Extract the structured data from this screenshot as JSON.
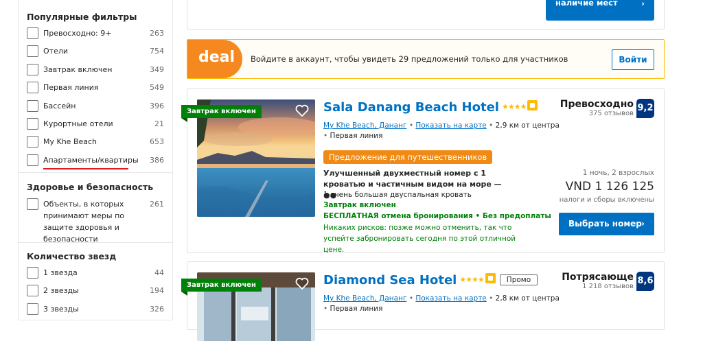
{
  "sidebar": {
    "popular": {
      "title": "Популярные фильтры",
      "items": [
        {
          "label": "Превосходно: 9+",
          "count": "263"
        },
        {
          "label": "Отели",
          "count": "754"
        },
        {
          "label": "Завтрак включен",
          "count": "349"
        },
        {
          "label": "Первая линия",
          "count": "549"
        },
        {
          "label": "Бассейн",
          "count": "396"
        },
        {
          "label": "Курортные отели",
          "count": "21"
        },
        {
          "label": "My Khe Beach",
          "count": "653"
        },
        {
          "label": "Апартаменты/квартиры",
          "count": "386"
        }
      ]
    },
    "health": {
      "title": "Здоровье и безопасность",
      "items": [
        {
          "label": "Объекты, в которых принимают меры по защите здоровья и безопасности",
          "count": "261"
        }
      ]
    },
    "stars": {
      "title": "Количество звезд",
      "items": [
        {
          "label": "1 звезда",
          "count": "44"
        },
        {
          "label": "2 звезды",
          "count": "194"
        },
        {
          "label": "3 звезды",
          "count": "326"
        }
      ]
    }
  },
  "top_card": {
    "button_label": "Посмотреть наличие мест"
  },
  "deal_banner": {
    "badge": "deal",
    "text": "Войдите в аккаунт, чтобы увидеть 29 предложений только для участников",
    "login_label": "Войти"
  },
  "hotels": [
    {
      "ribbon": "Завтрак включен",
      "name": "Sala Danang Beach Hotel",
      "stars": "★★★★",
      "location": "My Khe Beach, Дананг",
      "map_link": "Показать на карте",
      "distance": "2,9 км от центра",
      "line": "Первая линия",
      "offer": "Предложение для путешественников",
      "room": "Улучшенный двухместный номер с 1 кроватью и частичным видом на море —",
      "bed": "1 очень большая двуспальная кровать",
      "breakfast": "Завтрак включен",
      "cancel": "БЕСПЛАТНАЯ отмена бронирования • Без предоплаты",
      "risk": "Никаких рисков: позже можно отменить, так что успейте забронировать сегодня по этой отличной цене.",
      "rating_word": "Превосходно",
      "reviews": "375 отзывов",
      "score": "9,2",
      "occupancy": "1 ночь, 2 взрослых",
      "price": "VND 1 126 125",
      "taxes": "налоги и сборы включены",
      "button": "Выбрать номер"
    },
    {
      "ribbon": "Завтрак включен",
      "name": "Diamond Sea Hotel",
      "stars": "★★★★",
      "promo": "Промо",
      "location": "My Khe Beach, Дананг",
      "map_link": "Показать на карте",
      "distance": "2,8 км от центра",
      "line": "Первая линия",
      "rating_word": "Потрясающе",
      "reviews": "1 218 отзывов",
      "score": "8,6"
    }
  ],
  "colors": {
    "brand_blue": "#0071c2",
    "score_blue": "#003580",
    "green": "#008009",
    "deal_orange": "#f5891f",
    "star_yellow": "#febb02"
  }
}
